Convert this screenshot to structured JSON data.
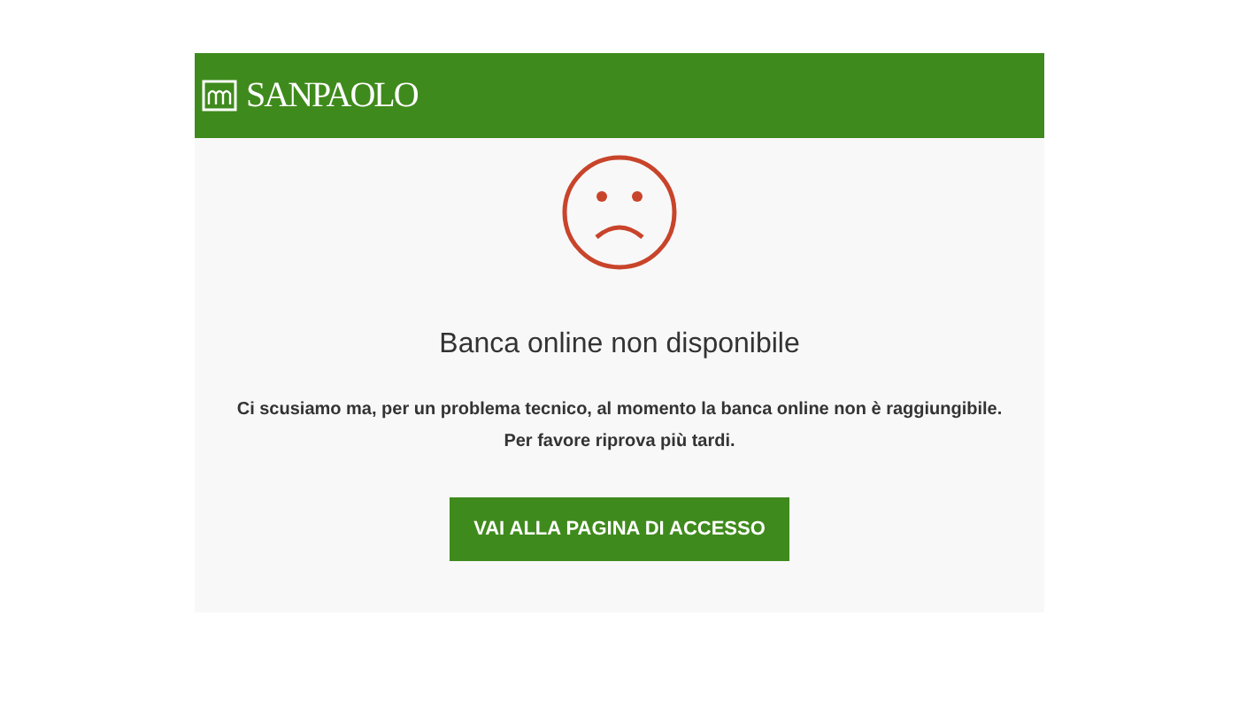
{
  "header": {
    "logo_text": "SANPAOLO"
  },
  "message": {
    "title": "Banca online non disponibile",
    "lines": [
      "Ci scusiamo ma, per un problema tecnico, al momento la banca online non è raggiungibile.",
      "Per favore riprova più tardi."
    ]
  },
  "button": {
    "label": "VAI ALLA PAGINA DI ACCESSO"
  }
}
